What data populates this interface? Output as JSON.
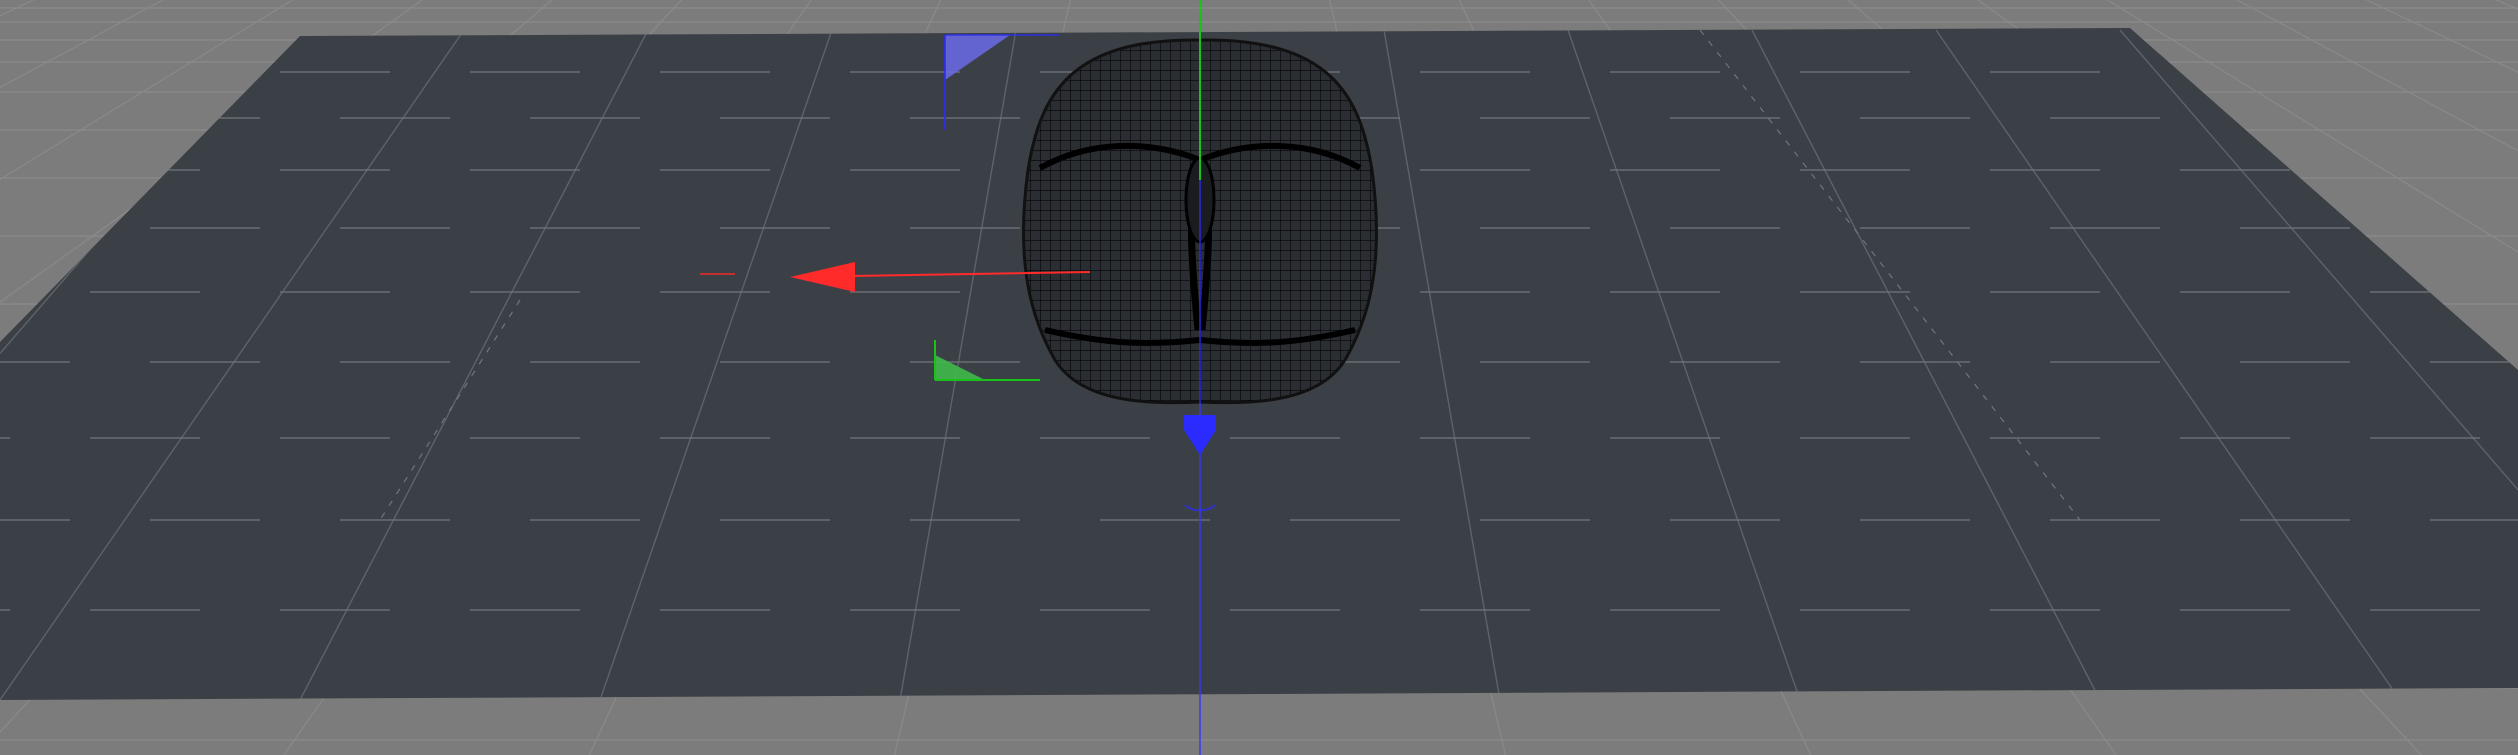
{
  "viewport": {
    "kind": "3d-viewport",
    "colors": {
      "background_grid": "#7c7c7c",
      "background_grid_lines": "#8a8a8a",
      "floor_plane": "#3b4046",
      "floor_grid_lines": "#5c636b",
      "floor_dash_lines": "#6f767e",
      "mesh_wire": "#000000",
      "mesh_fill": "#2a2d31",
      "axis_x": "#ff2a2a",
      "axis_y": "#19c219",
      "axis_z": "#2b2bff",
      "plane_xz_handle": "#6b6be8",
      "plane_xy_handle": "#3fb94a"
    },
    "objects": [
      {
        "name": "floor-plane",
        "type": "plane",
        "subdivided": true
      },
      {
        "name": "rounded-cushion-mesh",
        "type": "polygon-mesh",
        "display": "wireframe"
      }
    ],
    "gizmo": {
      "type": "move-tool",
      "axes": [
        "x",
        "y",
        "z"
      ],
      "plane_handles": [
        "xz",
        "xy"
      ],
      "icons": [
        "x-axis-arrow-icon",
        "z-axis-arrow-icon",
        "y-axis-line-icon"
      ]
    }
  }
}
